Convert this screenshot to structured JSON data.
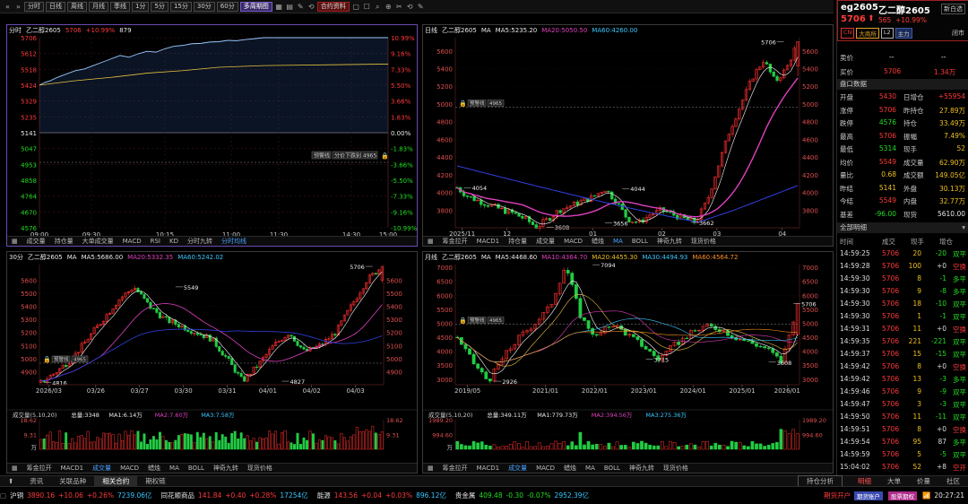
{
  "toolbar": {
    "buttons": [
      "分时",
      "日线",
      "周线",
      "月线",
      "季线",
      "1分",
      "5分",
      "15分",
      "30分",
      "60分",
      "多周期图",
      "合约资料"
    ],
    "active": "多周期图"
  },
  "symbol": "乙二醇2605",
  "intraday": {
    "header": [
      "分时",
      "乙二醇2605",
      "5706",
      "+10.99%",
      "879"
    ],
    "y_left": [
      "5706",
      "5612",
      "5518",
      "5424",
      "5329",
      "5235",
      "5141",
      "5047",
      "4953",
      "4858",
      "4764",
      "4670",
      "4576"
    ],
    "y_right": [
      "10.99%",
      "9.16%",
      "7.33%",
      "5.50%",
      "3.66%",
      "1.83%",
      "0.00%",
      "-1.83%",
      "-3.66%",
      "-5.50%",
      "-7.33%",
      "-9.16%",
      "-10.99%"
    ],
    "x": [
      "09:00",
      "09:30",
      "10:15",
      "11:00",
      "11:30",
      "14:30",
      "15:00"
    ],
    "label": "分价下跌别 4965",
    "warn": "预警线",
    "footer": [
      "成交量",
      "持仓量",
      "大单成交量",
      "MACD",
      "RSI",
      "KD",
      "分时九转",
      "分时均线"
    ]
  },
  "daily": {
    "header": [
      "日线",
      "乙二醇2605",
      "MA",
      "MA5:5235.20",
      "MA20:5050.50",
      "MA60:4260.00"
    ],
    "y": [
      "5600",
      "5400",
      "5200",
      "5000",
      "4800",
      "4600",
      "4400",
      "4200",
      "4000",
      "3800"
    ],
    "x": [
      "2025/11",
      "12",
      "01",
      "02",
      "03",
      "04"
    ],
    "ann": [
      "5706",
      "4044",
      "4054",
      "3608",
      "3656",
      "3662",
      "4965",
      "预警线"
    ],
    "footer": [
      "筹金拉开",
      "MACD1",
      "持仓量",
      "成交量",
      "MACD",
      "蜡烛",
      "MA",
      "BOLL",
      "神奇九转",
      "现货价格"
    ]
  },
  "m30": {
    "header": [
      "30分",
      "乙二醇2605",
      "MA",
      "MA5:5686.00",
      "MA20:5332.35",
      "MA60:5242.02"
    ],
    "y": [
      "5600",
      "5500",
      "5400",
      "5300",
      "5200",
      "5100",
      "5000",
      "4900"
    ],
    "x": [
      "2026/03",
      "03/26",
      "03/27",
      "03/30",
      "03/31",
      "04/01",
      "04/02",
      "04/03"
    ],
    "ann": [
      "5706",
      "5549",
      "4816",
      "4827",
      "4965",
      "预警线"
    ],
    "vol_header": [
      "成交量(5,10,20)",
      "总量:3348",
      "MA1:6.14万",
      "MA2:7.60万",
      "MA3:7.58万"
    ],
    "vol_y": [
      "18.62",
      "9.31",
      "万"
    ],
    "footer": [
      "筹金拉开",
      "MACD1",
      "成交量",
      "MACD",
      "蜡烛",
      "MA",
      "BOLL",
      "神奇九转",
      "现货价格"
    ]
  },
  "monthly": {
    "header": [
      "月线",
      "乙二醇2605",
      "MA",
      "MA5:4468.60",
      "MA10:4364.70",
      "MA20:4455.30",
      "MA30:4494.93",
      "MA60:4564.72"
    ],
    "y": [
      "7000",
      "6500",
      "6000",
      "5500",
      "5000",
      "4500",
      "4000",
      "3500",
      "3000"
    ],
    "x": [
      "2019/05",
      "2021/01",
      "2022/01",
      "2023/01",
      "2024/01",
      "2025/01",
      "2026/01"
    ],
    "ann": [
      "7094",
      "5706",
      "2926",
      "3715",
      "3608",
      "4965",
      "预警线"
    ],
    "vol_header": [
      "成交量(5,10,20)",
      "总量:349.11万",
      "MA1:779.73万",
      "MA2:394.56万",
      "MA3:275.36万"
    ],
    "vol_y": [
      "1989.20",
      "994.60",
      "万"
    ],
    "footer": [
      "筹金拉开",
      "MACD1",
      "成交量",
      "MACD",
      "蜡烛",
      "MA",
      "BOLL",
      "神奇九转",
      "现货价格"
    ]
  },
  "side": {
    "code": "eg2605",
    "name": "乙二醇2605",
    "price": "5706",
    "change": "565",
    "pct": "+10.99%",
    "tags": [
      "CN",
      "大商所",
      "L2",
      "主力"
    ],
    "close_tag": "闭市",
    "mode": "新白选",
    "sell": "卖价",
    "sell_v": "--",
    "sell_v2": "--",
    "buy": "买价",
    "buy_v": "5706",
    "buy_v2": "1.34万",
    "quote_title": "盘口数据",
    "quote": [
      [
        "开盘",
        "5430",
        "日增仓",
        "+55954"
      ],
      [
        "涨停",
        "5706",
        "昨持仓",
        "27.89万"
      ],
      [
        "跌停",
        "4576",
        "持仓",
        "33.49万"
      ],
      [
        "最高",
        "5706",
        "振幅",
        "7.49%"
      ],
      [
        "最低",
        "5314",
        "现手",
        "52"
      ],
      [
        "均价",
        "5549",
        "成交量",
        "62.90万"
      ],
      [
        "量比",
        "0.68",
        "成交额",
        "149.05亿"
      ],
      [
        "昨结",
        "5141",
        "外盘",
        "30.13万"
      ],
      [
        "今结",
        "5549",
        "内盘",
        "32.77万"
      ],
      [
        "基差",
        "-96.00",
        "现货",
        "5610.00"
      ]
    ],
    "detail_title": "全部明细",
    "detail_head": [
      "时间",
      "成交",
      "现手",
      "增仓"
    ],
    "detail": [
      [
        "14:59:25",
        "5706",
        "20",
        "-20",
        "双平"
      ],
      [
        "14:59:28",
        "5706",
        "100",
        "+0",
        "空换"
      ],
      [
        "14:59:30",
        "5706",
        "8",
        "-1",
        "多平"
      ],
      [
        "14:59:30",
        "5706",
        "9",
        "-8",
        "多平"
      ],
      [
        "14:59:30",
        "5706",
        "18",
        "-10",
        "双平"
      ],
      [
        "14:59:30",
        "5706",
        "1",
        "-1",
        "双平"
      ],
      [
        "14:59:31",
        "5706",
        "11",
        "+0",
        "空换"
      ],
      [
        "14:59:35",
        "5706",
        "221",
        "-221",
        "双平"
      ],
      [
        "14:59:37",
        "5706",
        "15",
        "-15",
        "双平"
      ],
      [
        "14:59:42",
        "5706",
        "8",
        "+0",
        "空换"
      ],
      [
        "14:59:42",
        "5706",
        "13",
        "-3",
        "多平"
      ],
      [
        "14:59:46",
        "5706",
        "9",
        "-9",
        "双平"
      ],
      [
        "14:59:47",
        "5706",
        "3",
        "-3",
        "双平"
      ],
      [
        "14:59:50",
        "5706",
        "11",
        "-11",
        "双平"
      ],
      [
        "14:59:51",
        "5706",
        "8",
        "+0",
        "空换"
      ],
      [
        "14:59:54",
        "5706",
        "95",
        "87",
        "多平"
      ],
      [
        "14:59:59",
        "5706",
        "5",
        "-5",
        "双平"
      ],
      [
        "15:04:02",
        "5706",
        "52",
        "+8",
        "空开"
      ]
    ],
    "tabs": [
      "明细",
      "大单",
      "价量",
      "社区"
    ]
  },
  "tickbar": [
    "资讯",
    "关联品种",
    "相关合约",
    "期权链"
  ],
  "tickbar_right": "持仓分析",
  "status": [
    [
      "沪铜",
      "3890.16",
      "+10.06",
      "+0.26%",
      "7239.06亿"
    ],
    [
      "同花顺商品",
      "141.84",
      "+0.40",
      "+0.28%",
      "17254亿"
    ],
    [
      "能源",
      "143.56",
      "+0.04",
      "+0.03%",
      "896.12亿"
    ],
    [
      "贵金属",
      "409.48",
      "-0.30",
      "-0.07%",
      "2952.39亿"
    ]
  ],
  "status_right": [
    "期货开户",
    "期货账户",
    "股票期权",
    "20:27:21"
  ]
}
